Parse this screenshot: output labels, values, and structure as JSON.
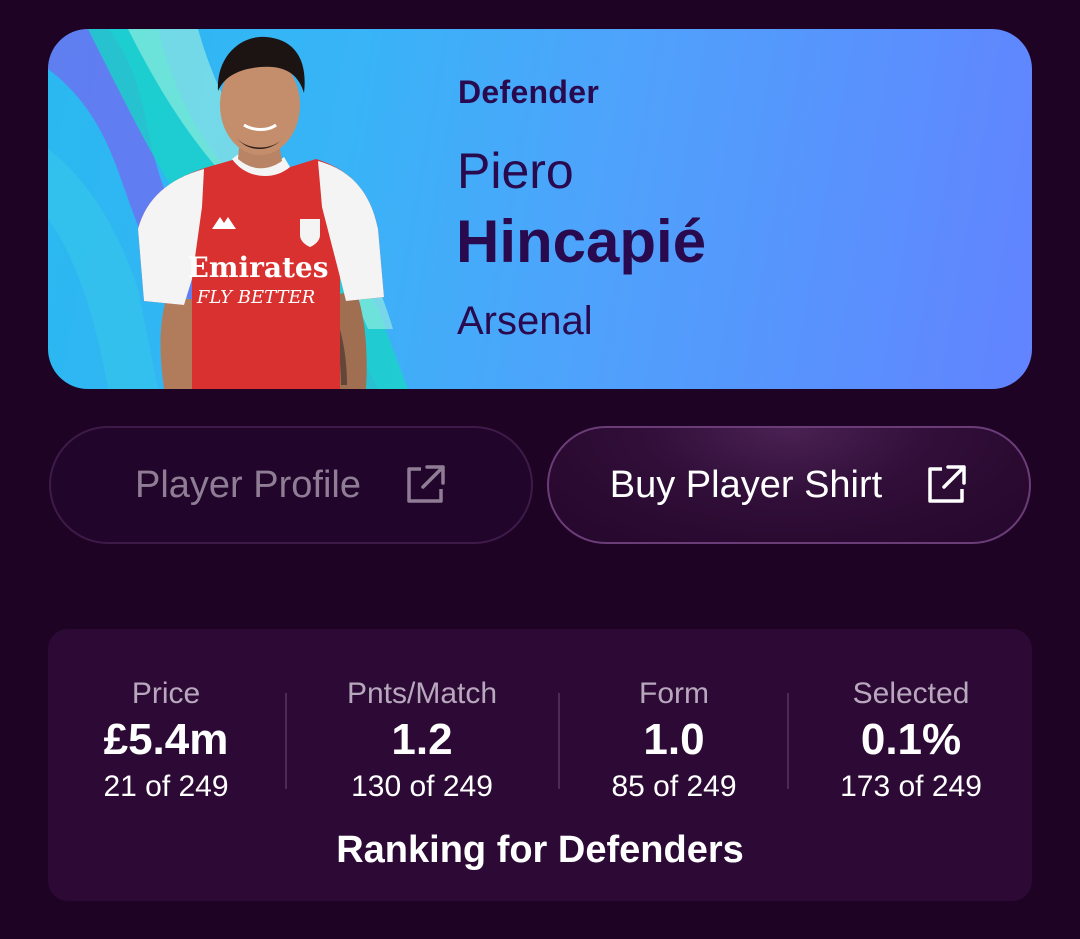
{
  "player": {
    "position": "Defender",
    "first_name": "Piero",
    "last_name": "Hincapié",
    "club": "Arsenal"
  },
  "buttons": {
    "profile_label": "Player Profile",
    "shirt_label": "Buy Player Shirt"
  },
  "stats": [
    {
      "label": "Price",
      "value": "£5.4m",
      "rank": "21 of 249"
    },
    {
      "label": "Pnts/Match",
      "value": "1.2",
      "rank": "130 of 249"
    },
    {
      "label": "Form",
      "value": "1.0",
      "rank": "85 of 249"
    },
    {
      "label": "Selected",
      "value": "0.1%",
      "rank": "173 of 249"
    }
  ],
  "ranking_title": "Ranking for Defenders",
  "icons": {
    "external_link": "external-link-icon"
  },
  "colors": {
    "background": "#1e0324",
    "card_gradient_start": "#2ab8f0",
    "card_gradient_end": "#6283ff",
    "heading_text": "#2a0a4e",
    "shirt_red": "#d8312f"
  }
}
